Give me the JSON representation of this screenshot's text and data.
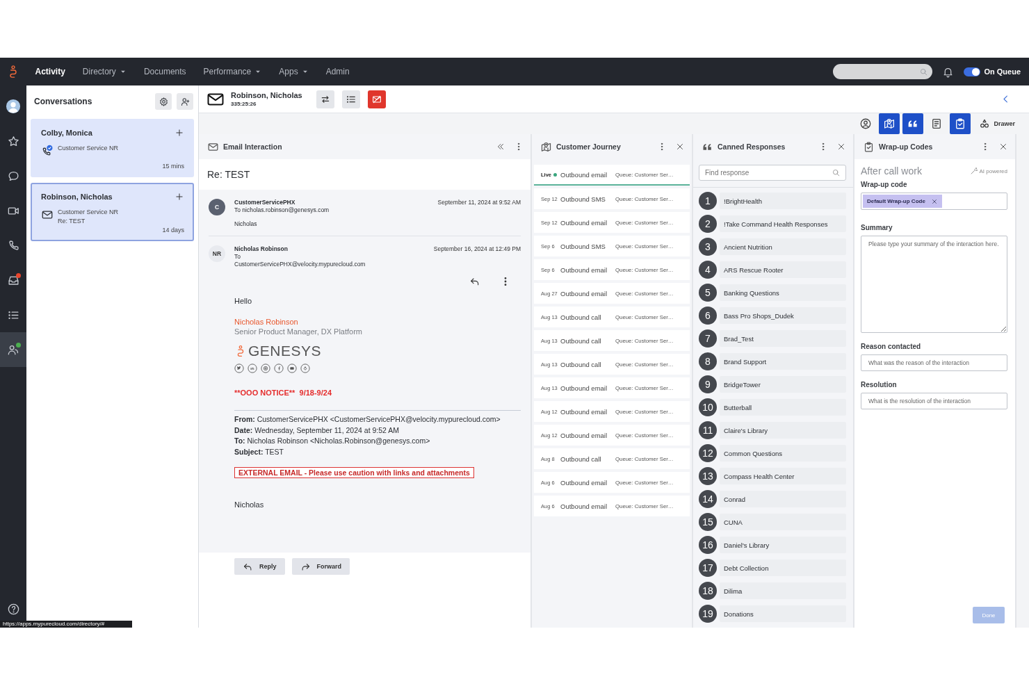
{
  "nav": {
    "items": [
      {
        "label": "Activity",
        "selected": true,
        "dropdown": false
      },
      {
        "label": "Directory",
        "selected": false,
        "dropdown": true
      },
      {
        "label": "Documents",
        "selected": false,
        "dropdown": false
      },
      {
        "label": "Performance",
        "selected": false,
        "dropdown": true
      },
      {
        "label": "Apps",
        "selected": false,
        "dropdown": true
      },
      {
        "label": "Admin",
        "selected": false,
        "dropdown": false
      }
    ],
    "status": {
      "label": "On Queue",
      "on": true
    }
  },
  "sidebar": {
    "items": [
      {
        "kind": "avatar",
        "selected": false
      },
      {
        "kind": "star",
        "selected": false
      },
      {
        "kind": "chat",
        "selected": false
      },
      {
        "kind": "video",
        "selected": false
      },
      {
        "kind": "phone",
        "selected": false
      },
      {
        "kind": "inbox",
        "selected": false,
        "color": "#e8452c"
      },
      {
        "kind": "list",
        "selected": false
      },
      {
        "kind": "agents",
        "selected": true,
        "color": "#4caf50"
      },
      {
        "kind": "help",
        "selected": false
      }
    ]
  },
  "conversations": {
    "title": "Conversations",
    "cards": [
      {
        "name": "Colby, Monica",
        "kind": "call",
        "queue": "Customer Service NR",
        "time": "15 mins",
        "selected": false
      },
      {
        "name": "Robinson, Nicholas",
        "kind": "email",
        "queue": "Customer Service NR",
        "subject": "Re: TEST",
        "time": "14 days",
        "selected": true
      }
    ]
  },
  "interaction": {
    "name": "Robinson, Nicholas",
    "timer": "335:25:26",
    "actions": [
      {
        "kind": "transfer"
      },
      {
        "kind": "list"
      },
      {
        "kind": "end"
      }
    ]
  },
  "toolbar": {
    "tools": [
      {
        "kind": "profile",
        "selected": false
      },
      {
        "kind": "journey",
        "selected": true
      },
      {
        "kind": "canned",
        "selected": true
      },
      {
        "kind": "script",
        "selected": false
      },
      {
        "kind": "wrapup",
        "selected": true
      }
    ],
    "drawer": "Drawer"
  },
  "email": {
    "title": "Email Interaction",
    "subject": "Re: TEST",
    "messages": [
      {
        "initials": "C",
        "sender": "CustomerServicePHX",
        "to": [
          "To nicholas.robinson@genesys.com"
        ],
        "date": "September 11, 2024 at 9:52 AM",
        "preview": "Nicholas",
        "expanded": false
      },
      {
        "initials": "NR",
        "sender": "Nicholas Robinson",
        "to": [
          "To",
          "CustomerServicePHX@velocity.mypurecloud.com"
        ],
        "date": "September 16, 2024 at 12:49 PM",
        "expanded": true
      }
    ],
    "body": {
      "greeting": "Hello",
      "signature_name": "Nicholas Robinson",
      "signature_title": "Senior Product Manager, DX Platform",
      "logo": "GENESYS",
      "notice": "**OOO NOTICE**  9/18-9/24",
      "quoted": [
        "**From:** CustomerServicePHX <CustomerServicePHX@velocity.mypurecloud.com>",
        "**Date:** Wednesday, September 11, 2024 at 9:52 AM",
        "**To:** Nicholas Robinson <Nicholas.Robinson@genesys.com>",
        "**Subject:** TEST"
      ],
      "banner": "EXTERNAL EMAIL - Please use caution with links and attachments",
      "closing": "Nicholas"
    },
    "buttons": [
      {
        "kind": "reply",
        "label": "Reply"
      },
      {
        "kind": "forward",
        "label": "Forward"
      }
    ]
  },
  "journey": {
    "title": "Customer Journey",
    "rows": [
      {
        "date": "Live",
        "live": true,
        "type": "Outbound email",
        "queue": "Queue: Customer Ser…"
      },
      {
        "date": "Sep 12",
        "live": false,
        "type": "Outbound SMS",
        "queue": "Queue: Customer Ser…"
      },
      {
        "date": "Sep 12",
        "live": false,
        "type": "Outbound email",
        "queue": "Queue: Customer Ser…"
      },
      {
        "date": "Sep 6",
        "live": false,
        "type": "Outbound SMS",
        "queue": "Queue: Customer Ser…"
      },
      {
        "date": "Sep 6",
        "live": false,
        "type": "Outbound email",
        "queue": "Queue: Customer Ser…"
      },
      {
        "date": "Aug 27",
        "live": false,
        "type": "Outbound email",
        "queue": "Queue: Customer Ser…"
      },
      {
        "date": "Aug 13",
        "live": false,
        "type": "Outbound call",
        "queue": "Queue: Customer Ser…"
      },
      {
        "date": "Aug 13",
        "live": false,
        "type": "Outbound call",
        "queue": "Queue: Customer Ser…"
      },
      {
        "date": "Aug 13",
        "live": false,
        "type": "Outbound call",
        "queue": "Queue: Customer Ser…"
      },
      {
        "date": "Aug 13",
        "live": false,
        "type": "Outbound email",
        "queue": "Queue: Customer Ser…"
      },
      {
        "date": "Aug 12",
        "live": false,
        "type": "Outbound email",
        "queue": "Queue: Customer Ser…"
      },
      {
        "date": "Aug 12",
        "live": false,
        "type": "Outbound email",
        "queue": "Queue: Customer Ser…"
      },
      {
        "date": "Aug 8",
        "live": false,
        "type": "Outbound call",
        "queue": "Queue: Customer Ser…"
      },
      {
        "date": "Aug 6",
        "live": false,
        "type": "Outbound email",
        "queue": "Queue: Customer Ser…"
      },
      {
        "date": "Aug 6",
        "live": false,
        "type": "Outbound email",
        "queue": "Queue: Customer Ser…"
      }
    ]
  },
  "canned": {
    "title": "Canned Responses",
    "search_placeholder": "Find response",
    "items": [
      {
        "number": "1",
        "label": "!BrightHealth"
      },
      {
        "number": "2",
        "label": "!Take Command Health Responses"
      },
      {
        "number": "3",
        "label": "Ancient Nutrition"
      },
      {
        "number": "4",
        "label": "ARS Rescue Rooter"
      },
      {
        "number": "5",
        "label": "Banking Questions"
      },
      {
        "number": "6",
        "label": "Bass Pro Shops_Dudek"
      },
      {
        "number": "7",
        "label": "Brad_Test"
      },
      {
        "number": "8",
        "label": "Brand Support"
      },
      {
        "number": "9",
        "label": "BridgeTower"
      },
      {
        "number": "10",
        "label": "Butterball"
      },
      {
        "number": "11",
        "label": "Claire's Library"
      },
      {
        "number": "12",
        "label": "Common Questions"
      },
      {
        "number": "13",
        "label": "Compass Health Center"
      },
      {
        "number": "14",
        "label": "Conrad"
      },
      {
        "number": "15",
        "label": "CUNA"
      },
      {
        "number": "16",
        "label": "Daniel's Library"
      },
      {
        "number": "17",
        "label": "Debt Collection"
      },
      {
        "number": "18",
        "label": "Dilima"
      },
      {
        "number": "19",
        "label": "Donations"
      }
    ]
  },
  "wrapup": {
    "title": "Wrap-up Codes",
    "heading": "After call work",
    "ai_label": "AI powered",
    "code_label": "Wrap-up code",
    "codes": [
      "Default Wrap-up Code"
    ],
    "fields": [
      {
        "kind": "textarea",
        "label": "Summary",
        "placeholder": "Please type your summary of the interaction here."
      },
      {
        "kind": "input",
        "label": "Reason contacted",
        "placeholder": "What was the reason of the interaction"
      },
      {
        "kind": "input",
        "label": "Resolution",
        "placeholder": "What is the resolution of the interaction"
      }
    ],
    "done": {
      "label": "Done",
      "disabled": true
    }
  },
  "status_url": "https://apps.mypurecloud.com/directory/#"
}
